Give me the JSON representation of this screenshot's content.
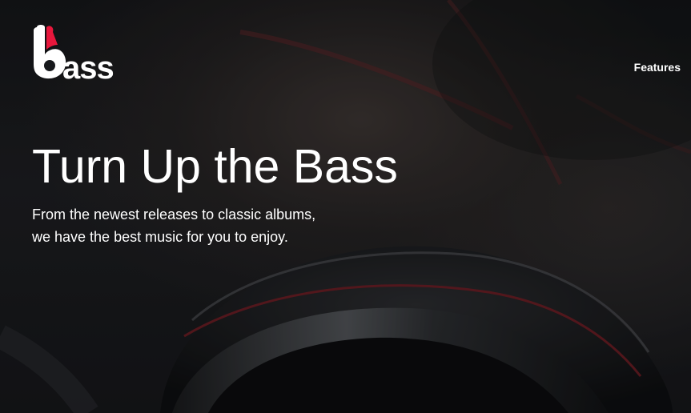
{
  "brand": {
    "logo_text": "bass",
    "accent_color": "#e8173c"
  },
  "nav": {
    "features_label": "Features"
  },
  "hero": {
    "headline": "Turn Up the Bass",
    "subtitle": "From the newest releases to classic albums, we have the best music for you to enjoy."
  }
}
